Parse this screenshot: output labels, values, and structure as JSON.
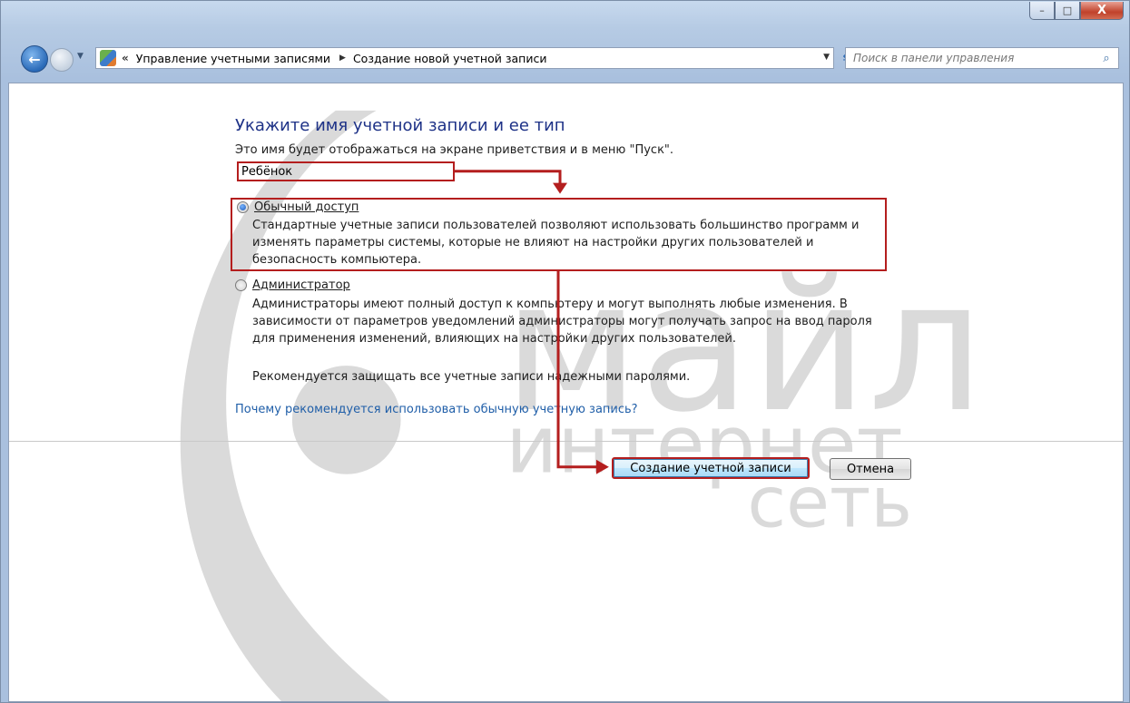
{
  "window": {
    "controls": {
      "minimize": "–",
      "maximize": "□",
      "close": "X"
    }
  },
  "nav": {
    "back_icon": "back-arrow-icon",
    "forward_icon": "forward-arrow-icon",
    "address": {
      "overflow": "«",
      "crumbs": [
        "Управление учетными записями",
        "Создание новой учетной записи"
      ],
      "separator": "▶"
    },
    "search": {
      "placeholder": "Поиск в панели управления"
    }
  },
  "main": {
    "title": "Укажите имя учетной записи и ее тип",
    "description": "Это имя будет отображаться на экране приветствия и в меню \"Пуск\".",
    "account_name": "Ребёнок",
    "options": [
      {
        "label": "Обычный доступ",
        "selected": true,
        "description": [
          "Стандартные учетные записи пользователей позволяют использовать большинство программ и",
          "изменять параметры системы, которые не влияют на настройки других пользователей и",
          "безопасность компьютера."
        ]
      },
      {
        "label": "Администратор",
        "selected": false,
        "description": [
          "Администраторы имеют полный доступ к компьютеру и могут выполнять любые изменения. В",
          "зависимости от параметров уведомлений администраторы могут получать запрос на ввод пароля",
          "для применения изменений, влияющих на настройки других пользователей."
        ]
      }
    ],
    "recommendation": "Рекомендуется защищать все учетные записи надежными паролями.",
    "help_link": "Почему рекомендуется использовать обычную учетную запись?",
    "buttons": {
      "create": "Создание учетной записи",
      "cancel": "Отмена"
    }
  },
  "watermark": {
    "line1": "майл",
    "line2": "интернет",
    "line3": "сеть"
  },
  "colors": {
    "title": "#1e3287",
    "link": "#1f5ea8",
    "highlight": "#b41e1e",
    "frame": "#b6cbe4"
  }
}
